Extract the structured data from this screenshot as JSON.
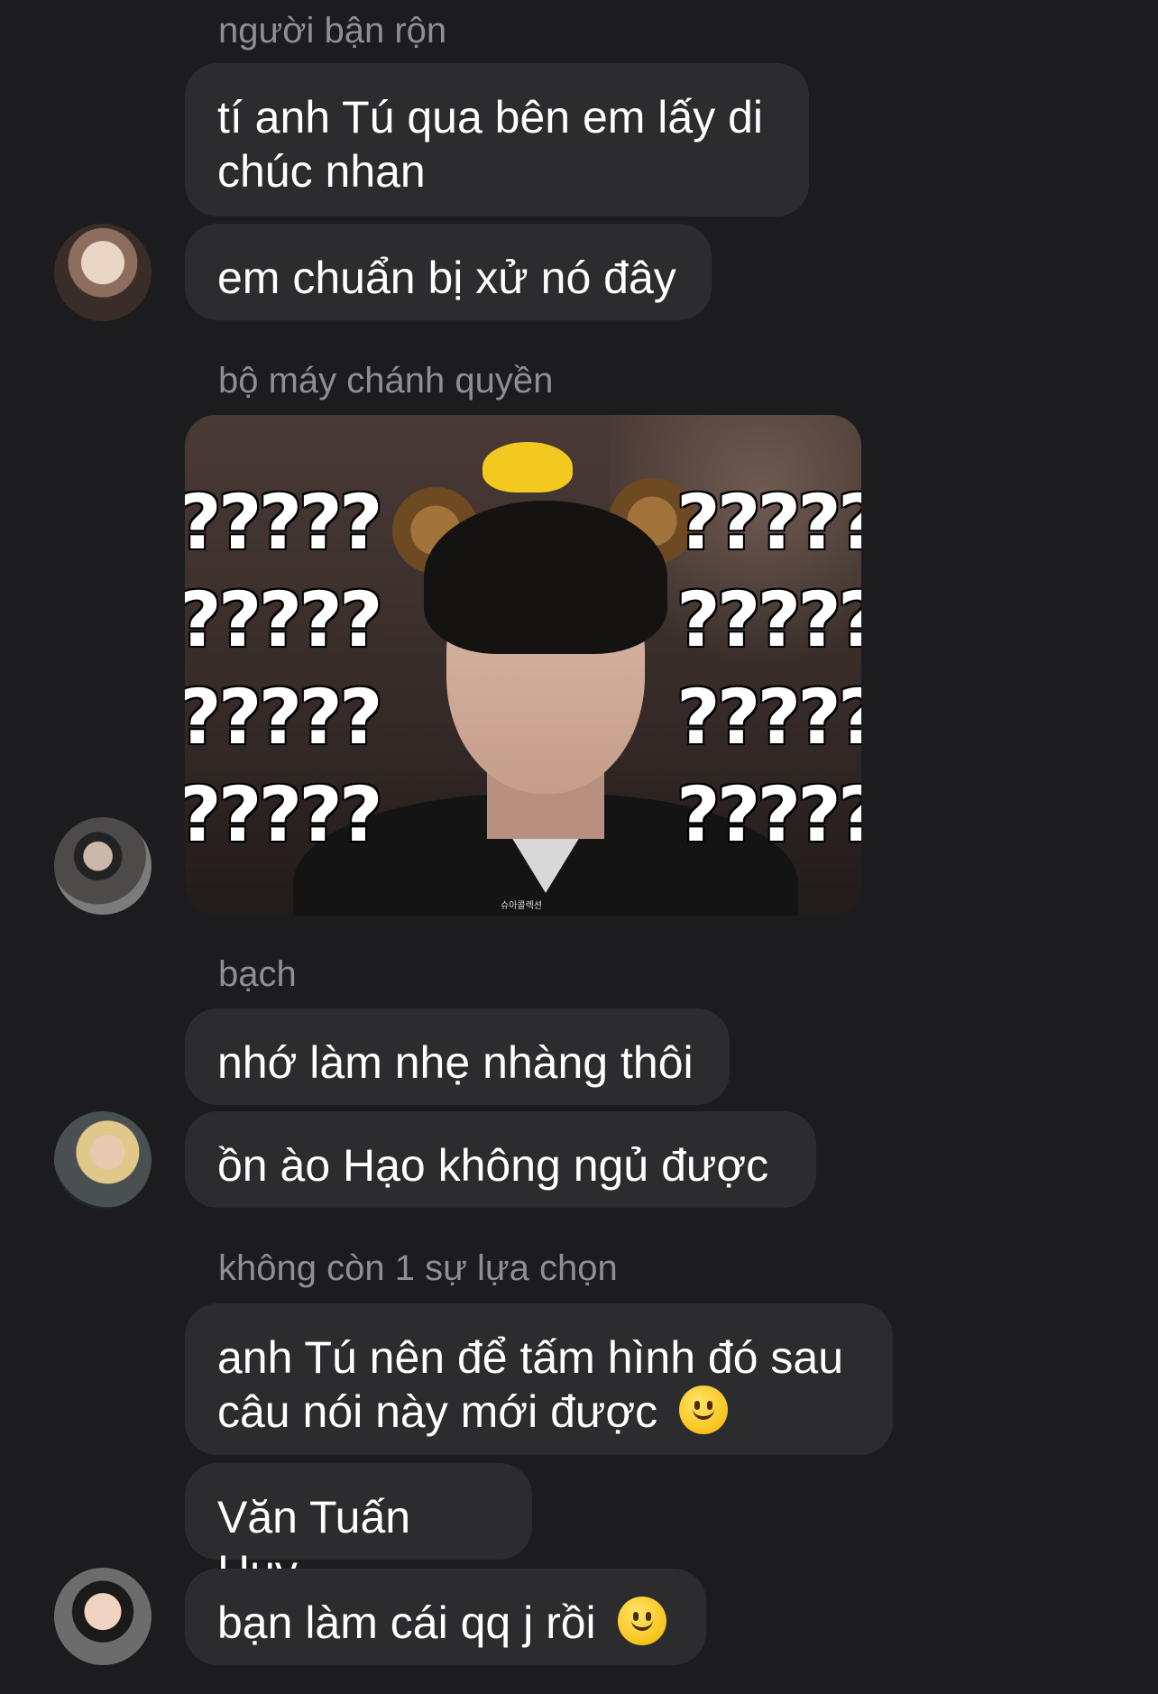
{
  "messages": [
    {
      "sender": "người bận rộn",
      "bubbles": [
        "tí anh Tú qua bên em lấy di chúc nhan",
        "em chuẩn bị xử nó đây"
      ]
    },
    {
      "sender": "bộ máy chánh quyền",
      "image": {
        "overlay_text": "?????",
        "watermark": "슈아콜렉션"
      }
    },
    {
      "sender": "bạch",
      "bubbles": [
        "nhớ làm nhẹ nhàng thôi",
        "ồn ào Hạo không ngủ được"
      ]
    },
    {
      "sender": "không còn 1 sự lựa chọn",
      "bubbles": [
        "anh Tú nên để tấm hình đó sau câu nói này mới được",
        "Văn Tuấn Huy",
        "bạn làm cái qq j rồi"
      ]
    }
  ],
  "emoji": "slightly-smiling-face",
  "colors": {
    "background": "#1c1c1e",
    "bubble": "#2c2c2e",
    "sender": "#8e8e93",
    "text": "#ffffff"
  }
}
